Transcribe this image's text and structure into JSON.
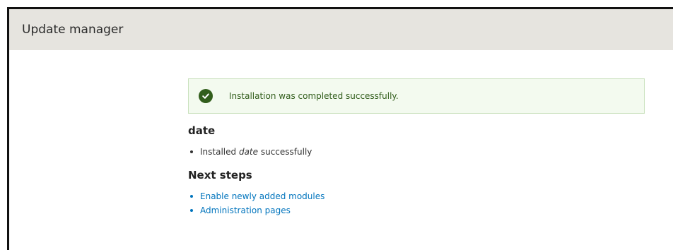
{
  "header": {
    "title": "Update manager"
  },
  "status_message": {
    "icon": "check-circle-icon",
    "text": "Installation was completed successfully.",
    "color": "#325e1c",
    "background": "#f3faef"
  },
  "project": {
    "heading": "date",
    "result_prefix": "Installed",
    "result_name": "date",
    "result_suffix": "successfully"
  },
  "next_steps": {
    "heading": "Next steps",
    "links": [
      {
        "label": "Enable newly added modules"
      },
      {
        "label": "Administration pages"
      }
    ],
    "link_color": "#0074bd"
  }
}
